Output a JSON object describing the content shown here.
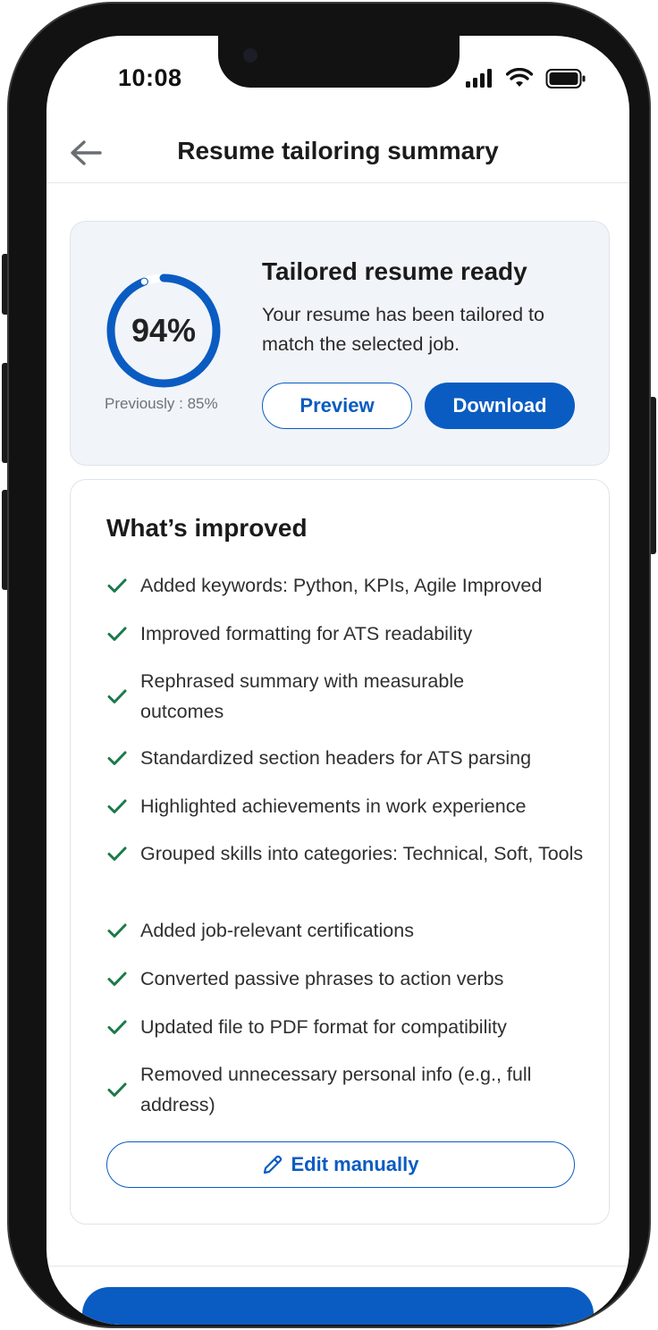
{
  "status_bar": {
    "time": "10:08"
  },
  "header": {
    "title": "Resume tailoring summary"
  },
  "score_card": {
    "score_text": "94%",
    "score_fraction": 0.94,
    "previous_text": "Previously : 85%",
    "title": "Tailored resume ready",
    "description": "Your resume has been tailored to match the selected job.",
    "preview_label": "Preview",
    "download_label": "Download"
  },
  "improvements": {
    "title": "What’s improved",
    "items": [
      "Added keywords: Python, KPIs, Agile Improved",
      "Improved formatting for ATS readability",
      "Rephrased summary with measurable outcomes",
      "Standardized section headers for ATS parsing",
      "Highlighted achievements in work experience",
      "Grouped skills into categories: Technical, Soft, Tools",
      "Added job-relevant certifications",
      "Converted passive phrases to action verbs",
      "Updated file to PDF format for compatibility",
      "Removed unnecessary personal info (e.g., full address)"
    ],
    "edit_label": "Edit manually"
  },
  "colors": {
    "primary": "#0a5cc2",
    "check": "#1b7a4a",
    "card_bg": "#f1f4f8"
  },
  "icons": {
    "back": "arrow-left-icon",
    "check": "checkmark-icon",
    "edit": "pencil-icon",
    "signal": "signal-icon",
    "wifi": "wifi-icon",
    "battery": "battery-icon"
  }
}
